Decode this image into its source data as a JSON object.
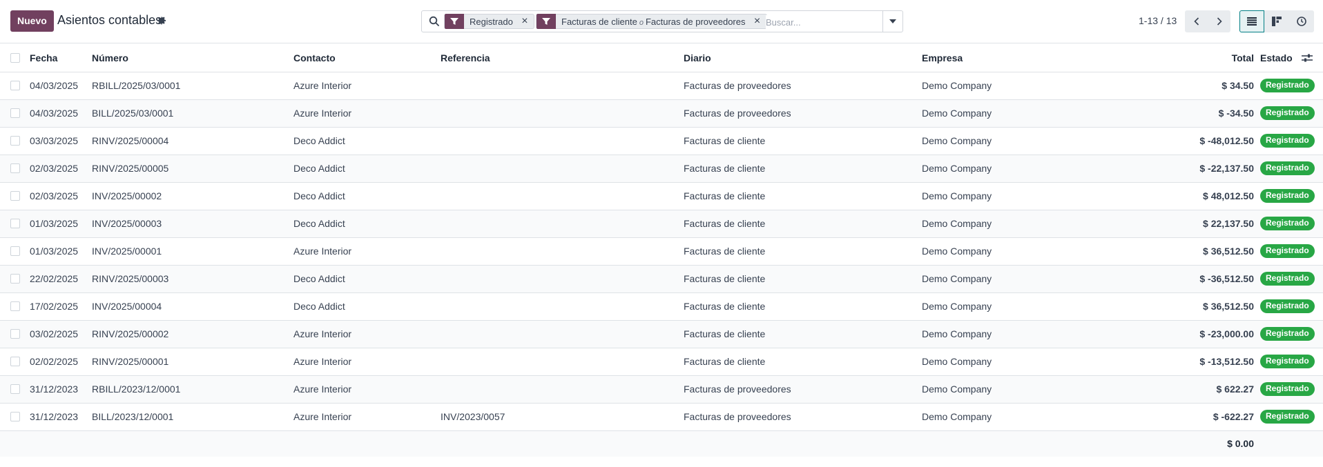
{
  "control_panel": {
    "new_label": "Nuevo",
    "title": "Asientos contables",
    "search": {
      "facets": [
        {
          "icon": "filter-icon",
          "values": [
            "Registrado"
          ]
        },
        {
          "icon": "filter-icon",
          "values": [
            "Facturas de cliente",
            "Facturas de proveedores"
          ],
          "separator": "o"
        }
      ],
      "placeholder": "Buscar..."
    },
    "pager": {
      "value": "1-13 / 13"
    },
    "views": [
      "list",
      "kanban",
      "activity"
    ],
    "active_view": "list"
  },
  "table": {
    "columns": {
      "date": "Fecha",
      "number": "Número",
      "partner": "Contacto",
      "ref": "Referencia",
      "journal": "Diario",
      "company": "Empresa",
      "total": "Total",
      "state": "Estado"
    },
    "rows": [
      {
        "date": "04/03/2025",
        "number": "RBILL/2025/03/0001",
        "partner": "Azure Interior",
        "ref": "",
        "journal": "Facturas de proveedores",
        "company": "Demo Company",
        "total": "$ 34.50",
        "state": "Registrado"
      },
      {
        "date": "04/03/2025",
        "number": "BILL/2025/03/0001",
        "partner": "Azure Interior",
        "ref": "",
        "journal": "Facturas de proveedores",
        "company": "Demo Company",
        "total": "$ -34.50",
        "state": "Registrado"
      },
      {
        "date": "03/03/2025",
        "number": "RINV/2025/00004",
        "partner": "Deco Addict",
        "ref": "",
        "journal": "Facturas de cliente",
        "company": "Demo Company",
        "total": "$ -48,012.50",
        "state": "Registrado"
      },
      {
        "date": "02/03/2025",
        "number": "RINV/2025/00005",
        "partner": "Deco Addict",
        "ref": "",
        "journal": "Facturas de cliente",
        "company": "Demo Company",
        "total": "$ -22,137.50",
        "state": "Registrado"
      },
      {
        "date": "02/03/2025",
        "number": "INV/2025/00002",
        "partner": "Deco Addict",
        "ref": "",
        "journal": "Facturas de cliente",
        "company": "Demo Company",
        "total": "$ 48,012.50",
        "state": "Registrado"
      },
      {
        "date": "01/03/2025",
        "number": "INV/2025/00003",
        "partner": "Deco Addict",
        "ref": "",
        "journal": "Facturas de cliente",
        "company": "Demo Company",
        "total": "$ 22,137.50",
        "state": "Registrado"
      },
      {
        "date": "01/03/2025",
        "number": "INV/2025/00001",
        "partner": "Azure Interior",
        "ref": "",
        "journal": "Facturas de cliente",
        "company": "Demo Company",
        "total": "$ 36,512.50",
        "state": "Registrado"
      },
      {
        "date": "22/02/2025",
        "number": "RINV/2025/00003",
        "partner": "Deco Addict",
        "ref": "",
        "journal": "Facturas de cliente",
        "company": "Demo Company",
        "total": "$ -36,512.50",
        "state": "Registrado"
      },
      {
        "date": "17/02/2025",
        "number": "INV/2025/00004",
        "partner": "Deco Addict",
        "ref": "",
        "journal": "Facturas de cliente",
        "company": "Demo Company",
        "total": "$ 36,512.50",
        "state": "Registrado"
      },
      {
        "date": "03/02/2025",
        "number": "RINV/2025/00002",
        "partner": "Azure Interior",
        "ref": "",
        "journal": "Facturas de cliente",
        "company": "Demo Company",
        "total": "$ -23,000.00",
        "state": "Registrado"
      },
      {
        "date": "02/02/2025",
        "number": "RINV/2025/00001",
        "partner": "Azure Interior",
        "ref": "",
        "journal": "Facturas de cliente",
        "company": "Demo Company",
        "total": "$ -13,512.50",
        "state": "Registrado"
      },
      {
        "date": "31/12/2023",
        "number": "RBILL/2023/12/0001",
        "partner": "Azure Interior",
        "ref": "",
        "journal": "Facturas de proveedores",
        "company": "Demo Company",
        "total": "$ 622.27",
        "state": "Registrado"
      },
      {
        "date": "31/12/2023",
        "number": "BILL/2023/12/0001",
        "partner": "Azure Interior",
        "ref": "INV/2023/0057",
        "journal": "Facturas de proveedores",
        "company": "Demo Company",
        "total": "$ -622.27",
        "state": "Registrado"
      }
    ],
    "footer_total": "$ 0.00"
  },
  "colors": {
    "brand": "#71405f",
    "state_posted": "#28a745",
    "active_view": "#017e84"
  }
}
